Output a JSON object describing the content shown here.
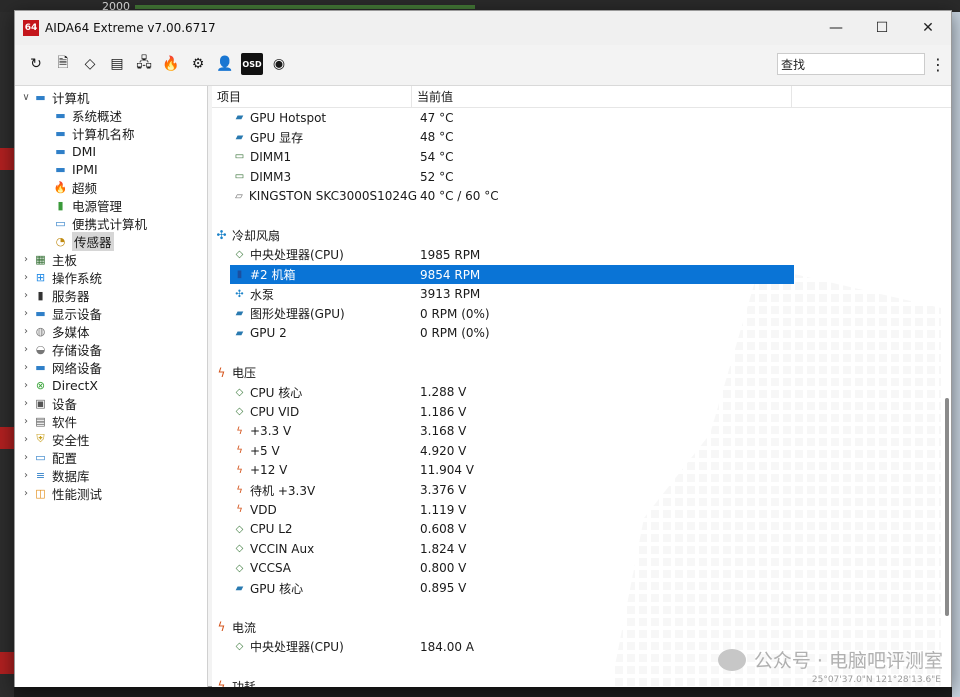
{
  "background": {
    "tick_label": "2000"
  },
  "window": {
    "app_icon": "64",
    "title": "AIDA64 Extreme v7.00.6717",
    "controls": {
      "minimize": "—",
      "maximize": "☐",
      "close": "✕"
    }
  },
  "toolbar": {
    "buttons": [
      {
        "name": "refresh-icon",
        "glyph": "↻"
      },
      {
        "name": "report-icon",
        "glyph": "🗎"
      },
      {
        "name": "motherboard-icon",
        "glyph": "◇"
      },
      {
        "name": "memory-icon",
        "glyph": "▤"
      },
      {
        "name": "network-icon",
        "glyph": "🖧"
      },
      {
        "name": "flame-icon",
        "glyph": "🔥"
      },
      {
        "name": "tools-icon",
        "glyph": "⚙"
      },
      {
        "name": "user-icon",
        "glyph": "👤"
      },
      {
        "name": "osd-icon",
        "glyph": "OSD"
      },
      {
        "name": "gauge-icon",
        "glyph": "◉"
      }
    ],
    "search_value": "查找",
    "menu_glyph": "⋮"
  },
  "tree": [
    {
      "label": "计算机",
      "indent": 0,
      "arrow": "∨",
      "icon": "computer-icon",
      "glyph": "▬",
      "color": "#2f7fc8"
    },
    {
      "label": "系统概述",
      "indent": 1,
      "arrow": "",
      "icon": "monitor-icon",
      "glyph": "▬",
      "color": "#2f7fc8"
    },
    {
      "label": "计算机名称",
      "indent": 1,
      "arrow": "",
      "icon": "monitor-icon",
      "glyph": "▬",
      "color": "#2f7fc8"
    },
    {
      "label": "DMI",
      "indent": 1,
      "arrow": "",
      "icon": "monitor-icon",
      "glyph": "▬",
      "color": "#2f7fc8"
    },
    {
      "label": "IPMI",
      "indent": 1,
      "arrow": "",
      "icon": "monitor-icon",
      "glyph": "▬",
      "color": "#2f7fc8"
    },
    {
      "label": "超频",
      "indent": 1,
      "arrow": "",
      "icon": "flame-icon",
      "glyph": "🔥",
      "color": "#e07020"
    },
    {
      "label": "电源管理",
      "indent": 1,
      "arrow": "",
      "icon": "power-icon",
      "glyph": "▮",
      "color": "#3a9a3a"
    },
    {
      "label": "便携式计算机",
      "indent": 1,
      "arrow": "",
      "icon": "laptop-icon",
      "glyph": "▭",
      "color": "#2f7fc8"
    },
    {
      "label": "传感器",
      "indent": 1,
      "arrow": "",
      "icon": "sensor-icon",
      "glyph": "◔",
      "color": "#c08a10",
      "selected": true
    },
    {
      "label": "主板",
      "indent": 0,
      "arrow": "›",
      "icon": "motherboard-icon",
      "glyph": "▦",
      "color": "#2e6b2e"
    },
    {
      "label": "操作系统",
      "indent": 0,
      "arrow": "›",
      "icon": "windows-icon",
      "glyph": "⊞",
      "color": "#1e88e5"
    },
    {
      "label": "服务器",
      "indent": 0,
      "arrow": "›",
      "icon": "server-icon",
      "glyph": "▮",
      "color": "#333"
    },
    {
      "label": "显示设备",
      "indent": 0,
      "arrow": "›",
      "icon": "display-icon",
      "glyph": "▬",
      "color": "#2f7fc8"
    },
    {
      "label": "多媒体",
      "indent": 0,
      "arrow": "›",
      "icon": "multimedia-icon",
      "glyph": "◍",
      "color": "#777"
    },
    {
      "label": "存储设备",
      "indent": 0,
      "arrow": "›",
      "icon": "storage-icon",
      "glyph": "◒",
      "color": "#777"
    },
    {
      "label": "网络设备",
      "indent": 0,
      "arrow": "›",
      "icon": "network-icon",
      "glyph": "▬",
      "color": "#2f7fc8"
    },
    {
      "label": "DirectX",
      "indent": 0,
      "arrow": "›",
      "icon": "directx-icon",
      "glyph": "⊗",
      "color": "#3aa53a"
    },
    {
      "label": "设备",
      "indent": 0,
      "arrow": "›",
      "icon": "devices-icon",
      "glyph": "▣",
      "color": "#555"
    },
    {
      "label": "软件",
      "indent": 0,
      "arrow": "›",
      "icon": "software-icon",
      "glyph": "▤",
      "color": "#555"
    },
    {
      "label": "安全性",
      "indent": 0,
      "arrow": "›",
      "icon": "shield-icon",
      "glyph": "⛨",
      "color": "#c8a020"
    },
    {
      "label": "配置",
      "indent": 0,
      "arrow": "›",
      "icon": "config-icon",
      "glyph": "▭",
      "color": "#2f7fc8"
    },
    {
      "label": "数据库",
      "indent": 0,
      "arrow": "›",
      "icon": "database-icon",
      "glyph": "≡",
      "color": "#2f7fc8"
    },
    {
      "label": "性能测试",
      "indent": 0,
      "arrow": "›",
      "icon": "benchmark-icon",
      "glyph": "◫",
      "color": "#e08a10"
    }
  ],
  "columns": {
    "item": "项目",
    "value": "当前值"
  },
  "rows": [
    {
      "kind": "item",
      "label": "GPU Hotspot",
      "value": "47 °C",
      "icon": "gpu-icon",
      "glyph": "▰",
      "color": "#2a7ab0"
    },
    {
      "kind": "item",
      "label": "GPU 显存",
      "value": "48 °C",
      "icon": "gpu-icon",
      "glyph": "▰",
      "color": "#2a7ab0"
    },
    {
      "kind": "item",
      "label": "DIMM1",
      "value": "54 °C",
      "icon": "memory-icon",
      "glyph": "▭",
      "color": "#2e6b2e"
    },
    {
      "kind": "item",
      "label": "DIMM3",
      "value": "52 °C",
      "icon": "memory-icon",
      "glyph": "▭",
      "color": "#2e6b2e"
    },
    {
      "kind": "item",
      "label": "KINGSTON SKC3000S1024G",
      "value": "40 °C / 60 °C",
      "icon": "disk-icon",
      "glyph": "▱",
      "color": "#666"
    },
    {
      "kind": "gap"
    },
    {
      "kind": "section",
      "label": "冷却风扇",
      "icon": "fan-icon",
      "glyph": "✣",
      "color": "#1d83c9"
    },
    {
      "kind": "item",
      "label": "中央处理器(CPU)",
      "value": "1985 RPM",
      "icon": "cpu-icon",
      "glyph": "◇",
      "color": "#3c7a3c"
    },
    {
      "kind": "item",
      "label": "#2 机箱",
      "value": "9854 RPM",
      "icon": "case-icon",
      "glyph": "▮",
      "color": "#1a4fa0",
      "selected": true
    },
    {
      "kind": "item",
      "label": "水泵",
      "value": "3913 RPM",
      "icon": "fan-icon",
      "glyph": "✣",
      "color": "#1d83c9"
    },
    {
      "kind": "item",
      "label": "图形处理器(GPU)",
      "value": "0 RPM  (0%)",
      "icon": "gpu-icon",
      "glyph": "▰",
      "color": "#2a7ab0"
    },
    {
      "kind": "item",
      "label": "GPU 2",
      "value": "0 RPM  (0%)",
      "icon": "gpu-icon",
      "glyph": "▰",
      "color": "#2a7ab0"
    },
    {
      "kind": "gap"
    },
    {
      "kind": "section",
      "label": "电压",
      "icon": "voltage-icon",
      "glyph": "ϟ",
      "color": "#d4541c"
    },
    {
      "kind": "item",
      "label": "CPU 核心",
      "value": "1.288 V",
      "icon": "cpu-icon",
      "glyph": "◇",
      "color": "#3c7a3c"
    },
    {
      "kind": "item",
      "label": "CPU VID",
      "value": "1.186 V",
      "icon": "cpu-icon",
      "glyph": "◇",
      "color": "#3c7a3c"
    },
    {
      "kind": "item",
      "label": "+3.3 V",
      "value": "3.168 V",
      "icon": "voltage-icon",
      "glyph": "ϟ",
      "color": "#d4541c"
    },
    {
      "kind": "item",
      "label": "+5 V",
      "value": "4.920 V",
      "icon": "voltage-icon",
      "glyph": "ϟ",
      "color": "#d4541c"
    },
    {
      "kind": "item",
      "label": "+12 V",
      "value": "11.904 V",
      "icon": "voltage-icon",
      "glyph": "ϟ",
      "color": "#d4541c"
    },
    {
      "kind": "item",
      "label": "待机 +3.3V",
      "value": "3.376 V",
      "icon": "voltage-icon",
      "glyph": "ϟ",
      "color": "#d4541c"
    },
    {
      "kind": "item",
      "label": "VDD",
      "value": "1.119 V",
      "icon": "voltage-icon",
      "glyph": "ϟ",
      "color": "#d4541c"
    },
    {
      "kind": "item",
      "label": "CPU L2",
      "value": "0.608 V",
      "icon": "cpu-icon",
      "glyph": "◇",
      "color": "#3c7a3c"
    },
    {
      "kind": "item",
      "label": "VCCIN Aux",
      "value": "1.824 V",
      "icon": "cpu-icon",
      "glyph": "◇",
      "color": "#3c7a3c"
    },
    {
      "kind": "item",
      "label": "VCCSA",
      "value": "0.800 V",
      "icon": "cpu-icon",
      "glyph": "◇",
      "color": "#3c7a3c"
    },
    {
      "kind": "item",
      "label": "GPU 核心",
      "value": "0.895 V",
      "icon": "gpu-icon",
      "glyph": "▰",
      "color": "#2a7ab0"
    },
    {
      "kind": "gap"
    },
    {
      "kind": "section",
      "label": "电流",
      "icon": "current-icon",
      "glyph": "ϟ",
      "color": "#d4541c"
    },
    {
      "kind": "item",
      "label": "中央处理器(CPU)",
      "value": "184.00 A",
      "icon": "cpu-icon",
      "glyph": "◇",
      "color": "#3c7a3c"
    },
    {
      "kind": "gap"
    },
    {
      "kind": "section",
      "label": "功耗",
      "icon": "power-icon",
      "glyph": "ϟ",
      "color": "#d4541c"
    }
  ],
  "watermark": {
    "text": "公众号 · 电脑吧评测室",
    "coords": "25°07'37.0\"N 121°28'13.6\"E"
  }
}
